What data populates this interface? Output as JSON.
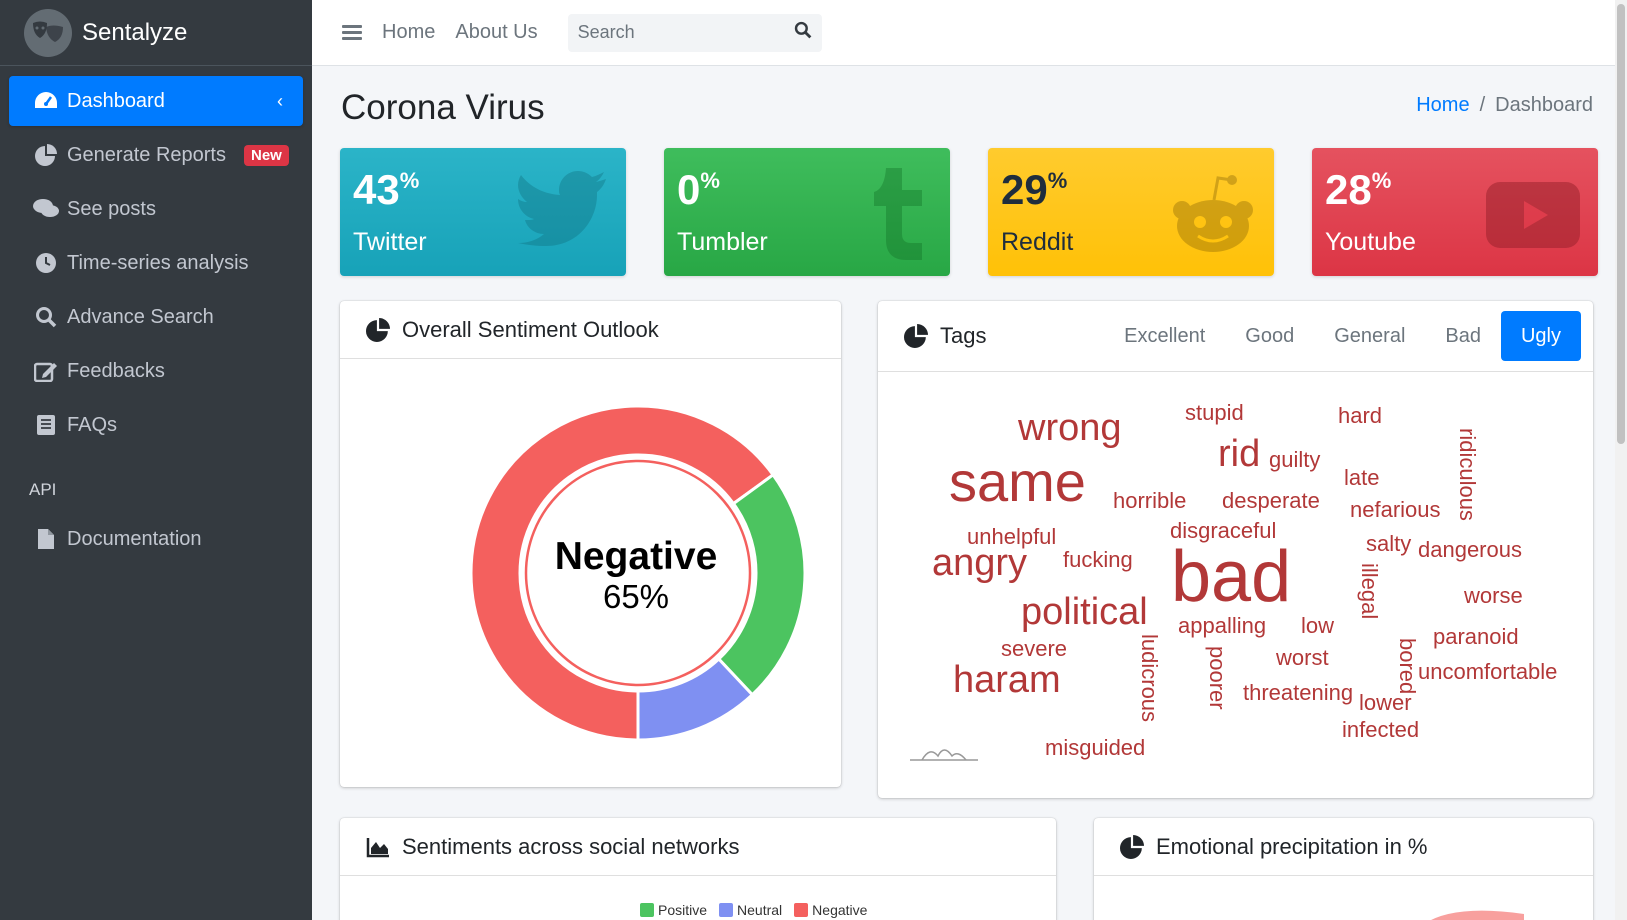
{
  "brand": {
    "name": "Sentalyze"
  },
  "sidebar": {
    "items": [
      {
        "label": "Dashboard",
        "icon": "dashboard-icon"
      },
      {
        "label": "Generate Reports",
        "icon": "pie-chart-icon",
        "badge": "New"
      },
      {
        "label": "See posts",
        "icon": "comments-icon"
      },
      {
        "label": "Time-series analysis",
        "icon": "clock-icon"
      },
      {
        "label": "Advance Search",
        "icon": "search-icon"
      },
      {
        "label": "Feedbacks",
        "icon": "edit-icon"
      },
      {
        "label": "FAQs",
        "icon": "book-icon"
      }
    ],
    "section_header": "API",
    "api_items": [
      {
        "label": "Documentation",
        "icon": "file-icon"
      }
    ]
  },
  "topbar": {
    "links": [
      "Home",
      "About Us"
    ],
    "search_placeholder": "Search"
  },
  "page": {
    "title": "Corona Virus",
    "breadcrumb": [
      "Home",
      "Dashboard"
    ]
  },
  "stats": [
    {
      "value": "43",
      "unit": "%",
      "label": "Twitter",
      "color": "#17a2b8"
    },
    {
      "value": "0",
      "unit": "%",
      "label": "Tumbler",
      "color": "#28a745"
    },
    {
      "value": "29",
      "unit": "%",
      "label": "Reddit",
      "color": "#ffc107"
    },
    {
      "value": "28",
      "unit": "%",
      "label": "Youtube",
      "color": "#dc3545"
    }
  ],
  "sentiment_card": {
    "title": "Overall Sentiment Outlook",
    "center_label": "Negative",
    "center_value": "65%"
  },
  "chart_data": {
    "type": "pie",
    "categories": [
      "Negative",
      "Positive",
      "Neutral"
    ],
    "values": [
      65,
      23,
      12
    ],
    "colors": [
      "#f4605e",
      "#4cc460",
      "#7f90f2"
    ]
  },
  "tags_card": {
    "title": "Tags",
    "tabs": [
      "Excellent",
      "Good",
      "General",
      "Bad",
      "Ugly"
    ],
    "active_tab": "Ugly",
    "words": [
      "wrong",
      "stupid",
      "hard",
      "ridiculous",
      "same",
      "rid",
      "guilty",
      "late",
      "horrible",
      "desperate",
      "nefarious",
      "unhelpful",
      "disgraceful",
      "salty",
      "dangerous",
      "angry",
      "fucking",
      "bad",
      "illegal",
      "worse",
      "political",
      "appalling",
      "low",
      "paranoid",
      "severe",
      "ludicrous",
      "poorer",
      "worst",
      "bored",
      "uncomfortable",
      "haram",
      "threatening",
      "lower",
      "infected",
      "misguided"
    ]
  },
  "networks_card": {
    "title": "Sentiments across social networks",
    "legend": [
      {
        "label": "Positive",
        "color": "#4cc460"
      },
      {
        "label": "Neutral",
        "color": "#7f90f2"
      },
      {
        "label": "Negative",
        "color": "#f4605e"
      }
    ]
  },
  "emotions_card": {
    "title": "Emotional precipitation in %"
  }
}
